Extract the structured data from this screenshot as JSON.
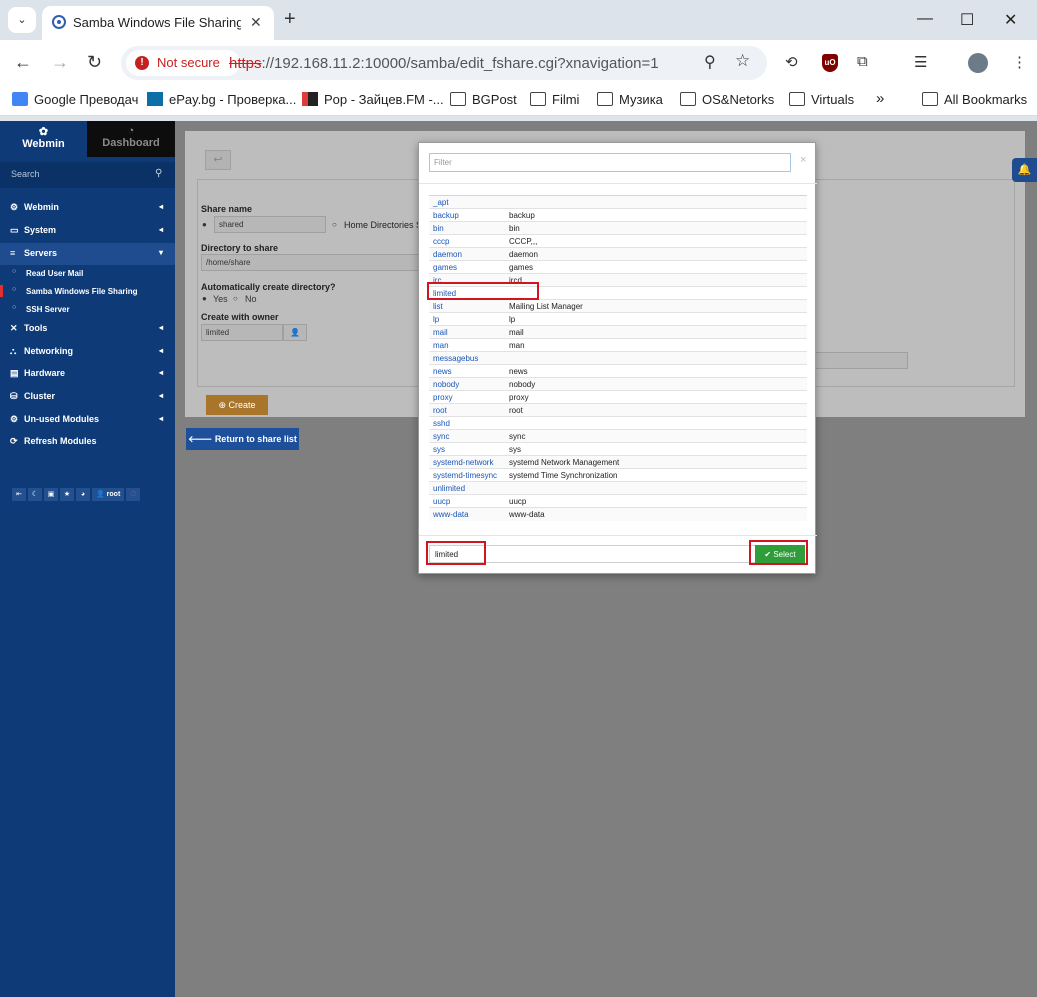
{
  "browser": {
    "tab_title": "Samba Windows File Sharing/C",
    "new_tab": "+",
    "tab_search": "⌄",
    "window_controls": [
      "—",
      "☐",
      "✕"
    ],
    "security_chip": "Not secure",
    "url_scheme": "https",
    "url_rest": "://192.168.11.2:10000/samba/edit_fshare.cgi?xnavigation=1",
    "bookmarks": [
      {
        "label": "Google Преводач",
        "icon": "google-translate-icon"
      },
      {
        "label": "ePay.bg - Проверка...",
        "icon": "epay-icon"
      },
      {
        "label": "Pop - Зайцев.FM -...",
        "icon": "radio-icon"
      },
      {
        "label": "BGPost",
        "icon": "folder-icon"
      },
      {
        "label": "Filmi",
        "icon": "folder-icon"
      },
      {
        "label": "Музика",
        "icon": "folder-icon"
      },
      {
        "label": "OS&Netorks",
        "icon": "folder-icon"
      },
      {
        "label": "Virtuals",
        "icon": "folder-icon"
      }
    ],
    "more_bookmarks": "»",
    "all_bookmarks": "All Bookmarks"
  },
  "sidebar": {
    "tab_webmin": "Webmin",
    "tab_dashboard": "Dashboard",
    "search_placeholder": "Search",
    "menu": [
      {
        "label": "Webmin",
        "icon": "⚙",
        "arrow": "◂"
      },
      {
        "label": "System",
        "icon": "▭",
        "arrow": "◂"
      },
      {
        "label": "Servers",
        "icon": "≡",
        "arrow": "▾"
      },
      {
        "label": "Tools",
        "icon": "✕",
        "arrow": "◂"
      },
      {
        "label": "Networking",
        "icon": "⛬",
        "arrow": "◂"
      },
      {
        "label": "Hardware",
        "icon": "▤",
        "arrow": "◂"
      },
      {
        "label": "Cluster",
        "icon": "⛁",
        "arrow": "◂"
      },
      {
        "label": "Un-used Modules",
        "icon": "⚙",
        "arrow": "◂"
      },
      {
        "label": "Refresh Modules",
        "icon": "⟳",
        "arrow": ""
      }
    ],
    "servers_sub": [
      "Read User Mail",
      "Samba Windows File Sharing",
      "SSH Server"
    ],
    "bottom_user": "root"
  },
  "form": {
    "share_name_label": "Share name",
    "share_name_value": "shared",
    "home_dirs_label": "Home Directories S",
    "directory_label": "Directory to share",
    "directory_value": "/home/share",
    "auto_create_label": "Automatically create directory?",
    "yes": "Yes",
    "no": "No",
    "owner_label": "Create with owner",
    "owner_value": "limited",
    "create_button": "Create",
    "return_button": "Return to share list"
  },
  "modal": {
    "filter_placeholder": "Filter",
    "close": "×",
    "users": [
      {
        "user": "_apt",
        "real": ""
      },
      {
        "user": "backup",
        "real": "backup"
      },
      {
        "user": "bin",
        "real": "bin"
      },
      {
        "user": "cccp",
        "real": "CCCP,,,"
      },
      {
        "user": "daemon",
        "real": "daemon"
      },
      {
        "user": "games",
        "real": "games"
      },
      {
        "user": "irc",
        "real": "ircd"
      },
      {
        "user": "limited",
        "real": ""
      },
      {
        "user": "list",
        "real": "Mailing List Manager"
      },
      {
        "user": "lp",
        "real": "lp"
      },
      {
        "user": "mail",
        "real": "mail"
      },
      {
        "user": "man",
        "real": "man"
      },
      {
        "user": "messagebus",
        "real": ""
      },
      {
        "user": "news",
        "real": "news"
      },
      {
        "user": "nobody",
        "real": "nobody"
      },
      {
        "user": "proxy",
        "real": "proxy"
      },
      {
        "user": "root",
        "real": "root"
      },
      {
        "user": "sshd",
        "real": ""
      },
      {
        "user": "sync",
        "real": "sync"
      },
      {
        "user": "sys",
        "real": "sys"
      },
      {
        "user": "systemd-network",
        "real": "systemd Network Management"
      },
      {
        "user": "systemd-timesync",
        "real": "systemd Time Synchronization"
      },
      {
        "user": "unlimited",
        "real": ""
      },
      {
        "user": "uucp",
        "real": "uucp"
      },
      {
        "user": "www-data",
        "real": "www-data"
      }
    ],
    "selected_value": "limited",
    "select_button": "Select"
  },
  "colors": {
    "sidebar": "#0e3a78",
    "overlay": "#7f7f80",
    "link": "#1a56b8",
    "select_green": "#2f9e3a",
    "create_orange": "#c8891b",
    "highlight_red": "#d01420"
  }
}
